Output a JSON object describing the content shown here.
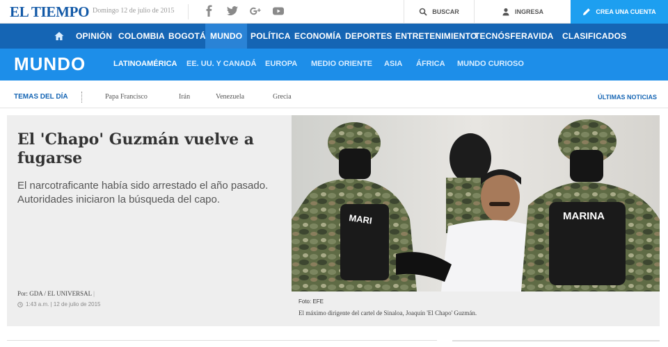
{
  "header": {
    "logo": "EL TIEMPO",
    "date": "Domingo 12 de julio de 2015",
    "social_icons": [
      "facebook-icon",
      "twitter-icon",
      "google-plus-icon",
      "youtube-icon"
    ],
    "search_label": "BUSCAR",
    "login_label": "INGRESA",
    "signup_label": "CREA UNA CUENTA"
  },
  "nav": {
    "home_icon": "home-icon",
    "items": [
      "OPINIÓN",
      "COLOMBIA",
      "BOGOTÁ",
      "MUNDO",
      "POLÍTICA",
      "ECONOMÍA",
      "DEPORTES",
      "ENTRETENIMIENTO",
      "TECNÓSFERA",
      "VIDA",
      "CLASIFICADOS"
    ],
    "active": "MUNDO"
  },
  "section": {
    "title": "MUNDO",
    "subnav": [
      "LATINOAMÉRICA",
      "EE. UU. Y CANADÁ",
      "EUROPA",
      "MEDIO ORIENTE",
      "ASIA",
      "ÁFRICA",
      "MUNDO CURIOSO"
    ],
    "active": "LATINOAMÉRICA"
  },
  "temas": {
    "label": "TEMAS DEL DÍA",
    "items": [
      "Papa Francisco",
      "Irán",
      "Venezuela",
      "Grecia"
    ],
    "ultimas": "ÚLTIMAS NOTICIAS"
  },
  "article": {
    "headline": "El 'Chapo' Guzmán vuelve a fugarse",
    "lead": "El narcotraficante había sido arrestado el año pasado. Autoridades iniciaron la búsqueda del capo.",
    "byline_prefix": "Por:",
    "byline_author": "GDA / EL UNIVERSAL",
    "byline_sep": "|",
    "time": "1:43 a.m. | 12 de julio de 2015",
    "photo_credit": "Foto: EFE",
    "photo_caption": "El máximo dirigente del cartel de Sinaloa, Joaquín 'El Chapo' Guzmán.",
    "photo_vest_label": "MARINA",
    "photo_vest_label_short": "MARI"
  },
  "colors": {
    "brand_blue": "#1565b4",
    "section_blue": "#1d8ee9",
    "cta_blue": "#1d9ff0"
  }
}
